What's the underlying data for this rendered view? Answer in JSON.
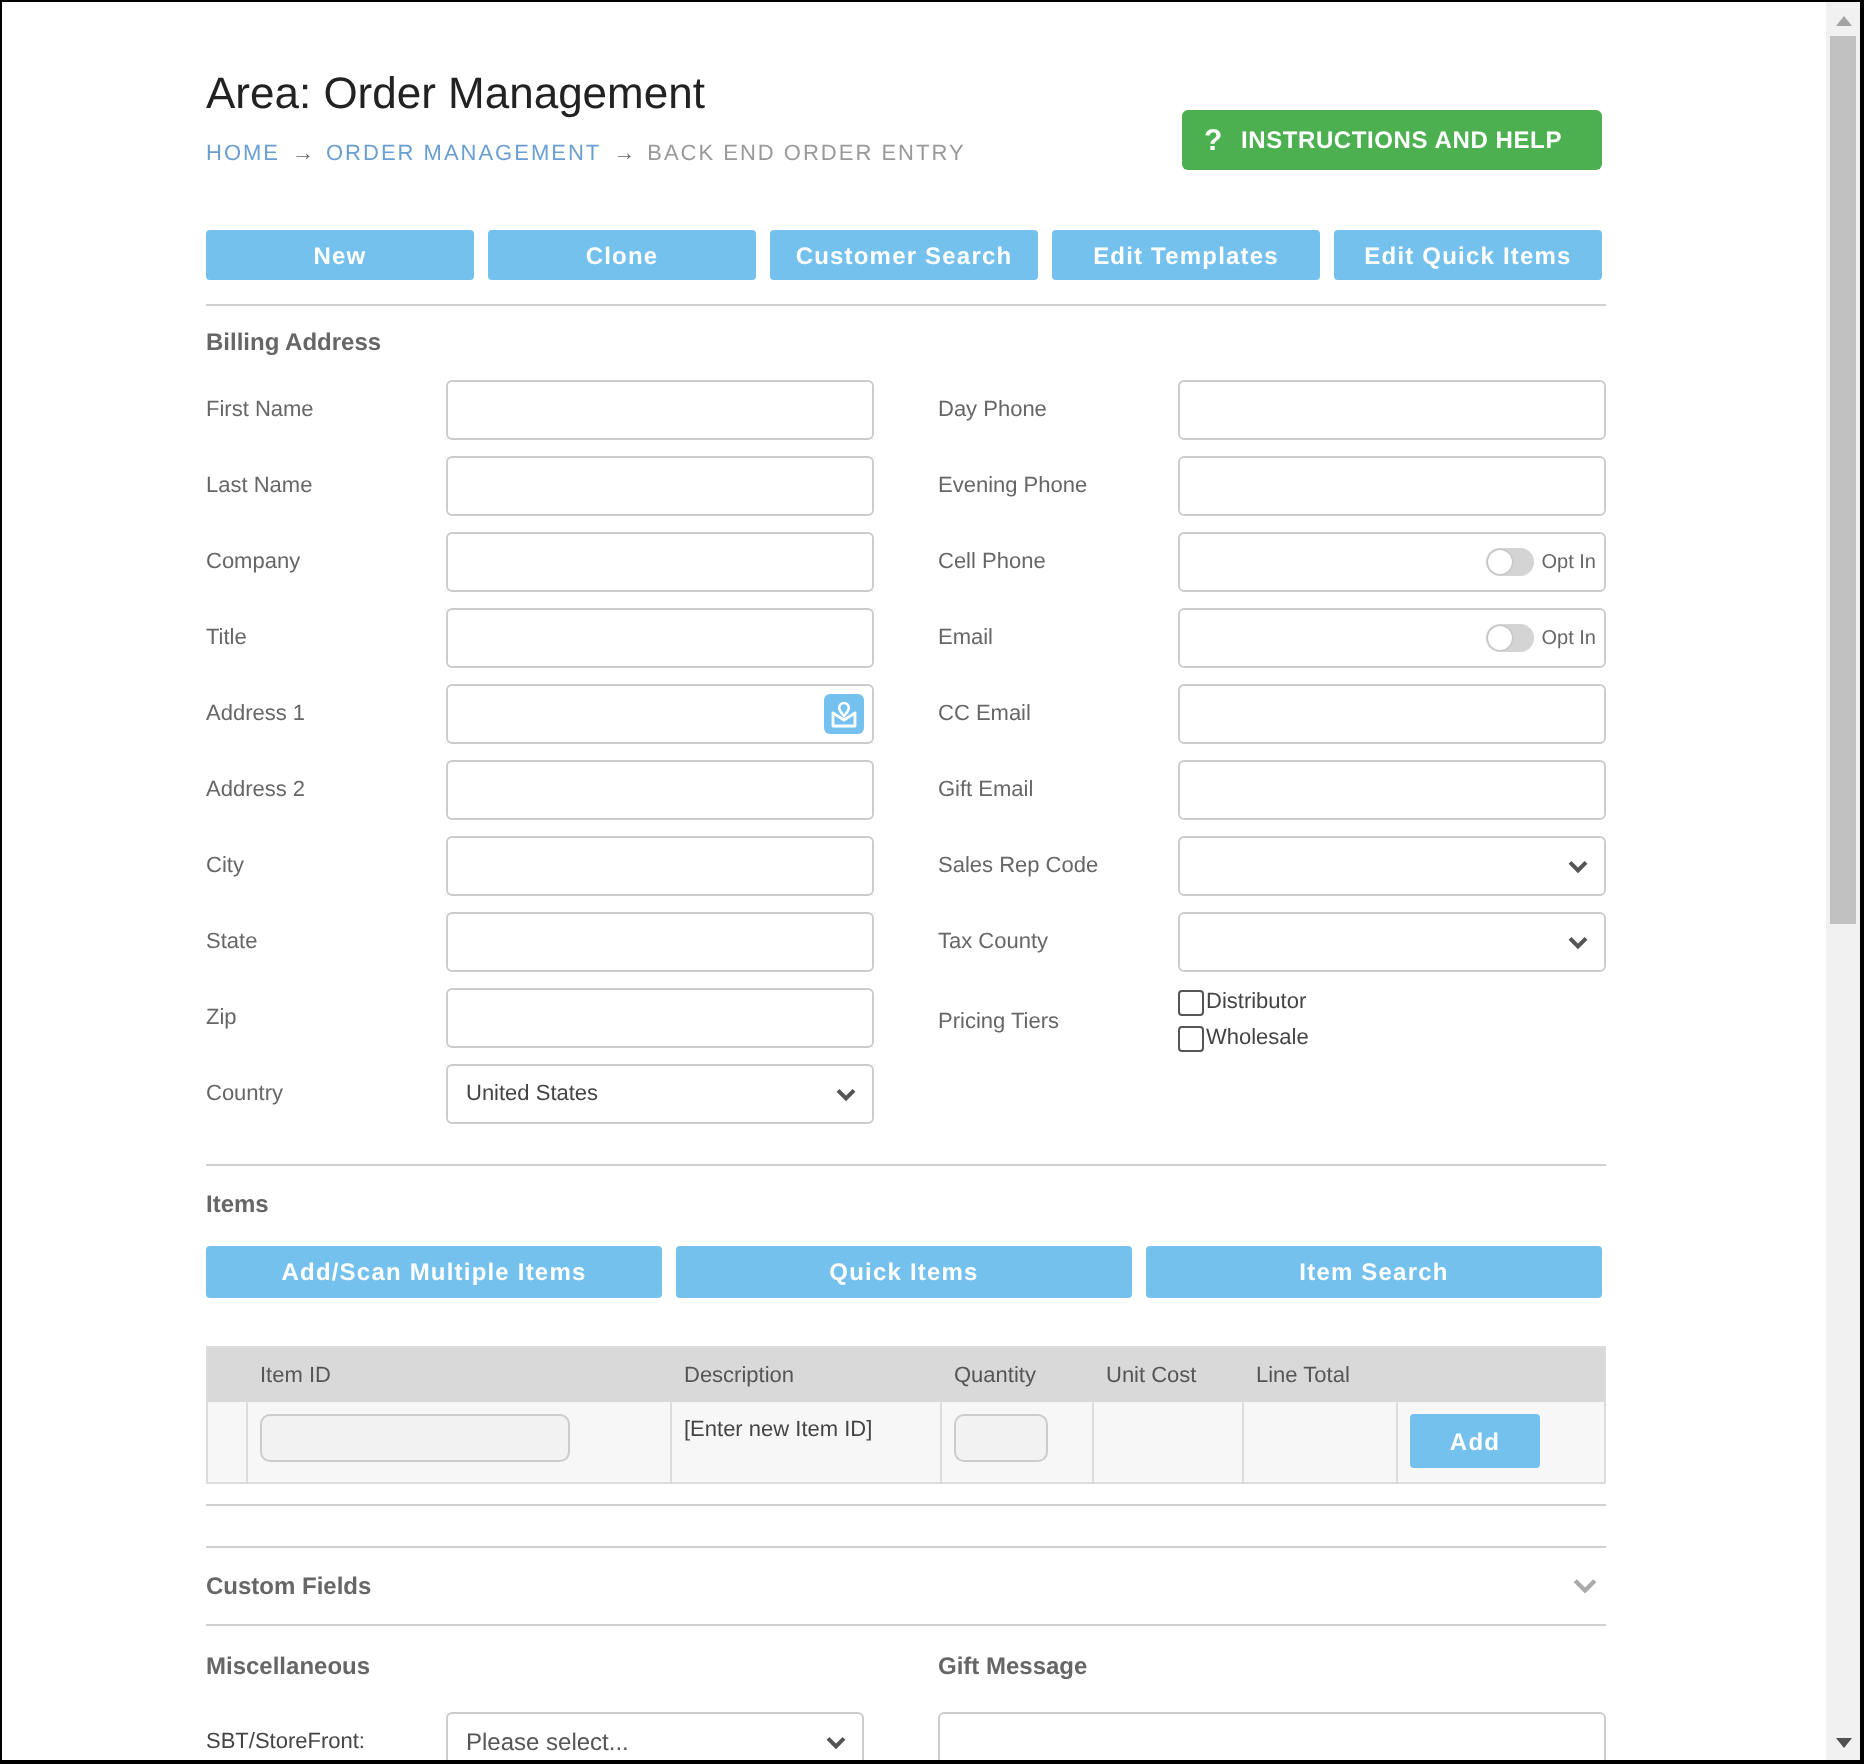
{
  "header": {
    "title": "Area: Order Management",
    "breadcrumb": [
      {
        "label": "HOME",
        "kind": "link"
      },
      {
        "label": "→",
        "kind": "arrow"
      },
      {
        "label": "ORDER MANAGEMENT",
        "kind": "link"
      },
      {
        "label": "→",
        "kind": "arrow"
      },
      {
        "label": "BACK END ORDER ENTRY",
        "kind": "current"
      }
    ],
    "help_button": {
      "icon": "?",
      "label": "INSTRUCTIONS AND HELP"
    }
  },
  "toolbar": [
    "New",
    "Clone",
    "Customer Search",
    "Edit Templates",
    "Edit Quick Items"
  ],
  "billing_address": {
    "heading": "Billing Address",
    "left": [
      {
        "label": "First Name",
        "kind": "text"
      },
      {
        "label": "Last Name",
        "kind": "text"
      },
      {
        "label": "Company",
        "kind": "text"
      },
      {
        "label": "Title",
        "kind": "text"
      },
      {
        "label": "Address 1",
        "kind": "lookup"
      },
      {
        "label": "Address 2",
        "kind": "text"
      },
      {
        "label": "City",
        "kind": "text"
      },
      {
        "label": "State",
        "kind": "text"
      },
      {
        "label": "Zip",
        "kind": "text"
      },
      {
        "label": "Country",
        "kind": "select",
        "value": "United States"
      }
    ],
    "right": [
      {
        "label": "Day Phone",
        "kind": "text"
      },
      {
        "label": "Evening Phone",
        "kind": "text"
      },
      {
        "label": "Cell Phone",
        "kind": "opt_in",
        "toggle": {
          "label": "Opt In",
          "on": false
        }
      },
      {
        "label": "Email",
        "kind": "opt_in",
        "toggle": {
          "label": "Opt In",
          "on": false
        }
      },
      {
        "label": "CC Email",
        "kind": "text"
      },
      {
        "label": "Gift Email",
        "kind": "text"
      },
      {
        "label": "Sales Rep Code",
        "kind": "select"
      },
      {
        "label": "Tax County",
        "kind": "select"
      },
      {
        "label": "Pricing Tiers",
        "kind": "checkboxes",
        "options": [
          {
            "label": "Distributor",
            "checked": false
          },
          {
            "label": "Wholesale",
            "checked": false
          }
        ]
      }
    ]
  },
  "items": {
    "heading": "Items",
    "buttons": [
      "Add/Scan Multiple Items",
      "Quick Items",
      "Item Search"
    ],
    "table": {
      "columns": [
        "Item ID",
        "Description",
        "Quantity",
        "Unit Cost",
        "Line Total"
      ],
      "rows": [
        {
          "description": "[Enter new Item ID]",
          "action": "Add"
        }
      ]
    }
  },
  "custom_fields": {
    "heading": "Custom Fields",
    "expanded": false
  },
  "miscellaneous": {
    "heading": "Miscellaneous",
    "fields": [
      {
        "label": "SBT/StoreFront:",
        "kind": "select",
        "placeholder": "Please select..."
      }
    ]
  },
  "gift_message": {
    "heading": "Gift Message"
  }
}
